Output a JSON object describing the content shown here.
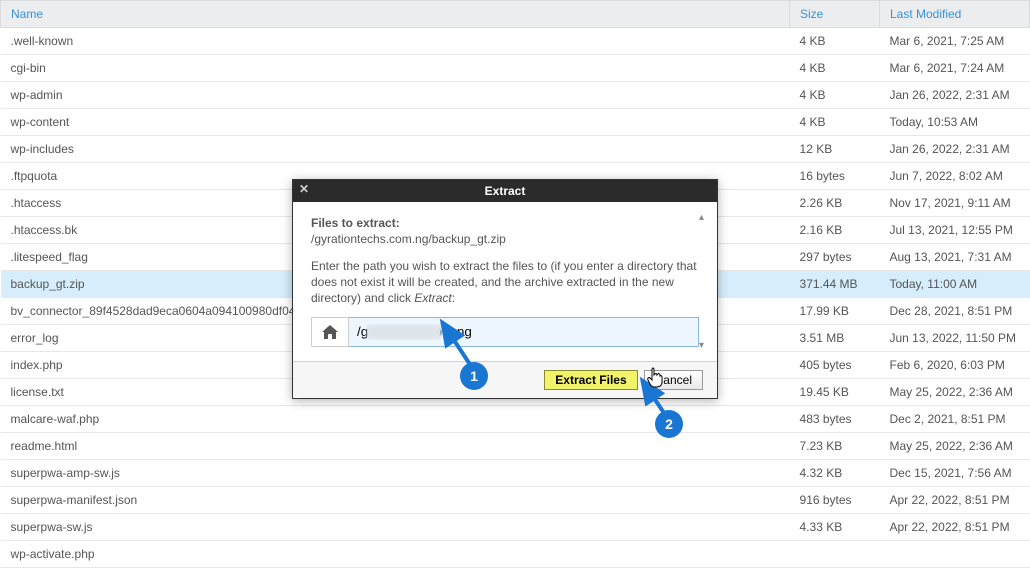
{
  "headers": {
    "name": "Name",
    "size": "Size",
    "modified": "Last Modified"
  },
  "rows": [
    {
      "name": ".well-known",
      "size": "4 KB",
      "modified": "Mar 6, 2021, 7:25 AM"
    },
    {
      "name": "cgi-bin",
      "size": "4 KB",
      "modified": "Mar 6, 2021, 7:24 AM"
    },
    {
      "name": "wp-admin",
      "size": "4 KB",
      "modified": "Jan 26, 2022, 2:31 AM"
    },
    {
      "name": "wp-content",
      "size": "4 KB",
      "modified": "Today, 10:53 AM"
    },
    {
      "name": "wp-includes",
      "size": "12 KB",
      "modified": "Jan 26, 2022, 2:31 AM"
    },
    {
      "name": ".ftpquota",
      "size": "16 bytes",
      "modified": "Jun 7, 2022, 8:02 AM"
    },
    {
      "name": ".htaccess",
      "size": "2.26 KB",
      "modified": "Nov 17, 2021, 9:11 AM"
    },
    {
      "name": ".htaccess.bk",
      "size": "2.16 KB",
      "modified": "Jul 13, 2021, 12:55 PM"
    },
    {
      "name": ".litespeed_flag",
      "size": "297 bytes",
      "modified": "Aug 13, 2021, 7:31 AM"
    },
    {
      "name": "backup_gt.zip",
      "size": "371.44 MB",
      "modified": "Today, 11:00 AM",
      "selected": true
    },
    {
      "name": "bv_connector_89f4528dad9eca0604a094100980df04",
      "size": "17.99 KB",
      "modified": "Dec 28, 2021, 8:51 PM"
    },
    {
      "name": "error_log",
      "size": "3.51 MB",
      "modified": "Jun 13, 2022, 11:50 PM"
    },
    {
      "name": "index.php",
      "size": "405 bytes",
      "modified": "Feb 6, 2020, 6:03 PM"
    },
    {
      "name": "license.txt",
      "size": "19.45 KB",
      "modified": "May 25, 2022, 2:36 AM"
    },
    {
      "name": "malcare-waf.php",
      "size": "483 bytes",
      "modified": "Dec 2, 2021, 8:51 PM"
    },
    {
      "name": "readme.html",
      "size": "7.23 KB",
      "modified": "May 25, 2022, 2:36 AM"
    },
    {
      "name": "superpwa-amp-sw.js",
      "size": "4.32 KB",
      "modified": "Dec 15, 2021, 7:56 AM"
    },
    {
      "name": "superpwa-manifest.json",
      "size": "916 bytes",
      "modified": "Apr 22, 2022, 8:51 PM"
    },
    {
      "name": "superpwa-sw.js",
      "size": "4.33 KB",
      "modified": "Apr 22, 2022, 8:51 PM"
    },
    {
      "name": "wp-activate.php",
      "size": "",
      "modified": ""
    }
  ],
  "dialog": {
    "title": "Extract",
    "close": "✕",
    "filesLabel": "Files to extract:",
    "filePath": "/gyrationtechs.com.ng/backup_gt.zip",
    "hint_pre": "Enter the path you wish to extract the files to (if you enter a directory that does not exist it will be created, and the archive extracted in the new directory) and click ",
    "hint_em": "Extract",
    "hint_post": ":",
    "path_prefix": "/g",
    "path_suffix": "om.ng",
    "extractBtn": "Extract Files",
    "cancelBtn": "Cancel"
  },
  "annotations": {
    "one": "1",
    "two": "2"
  }
}
